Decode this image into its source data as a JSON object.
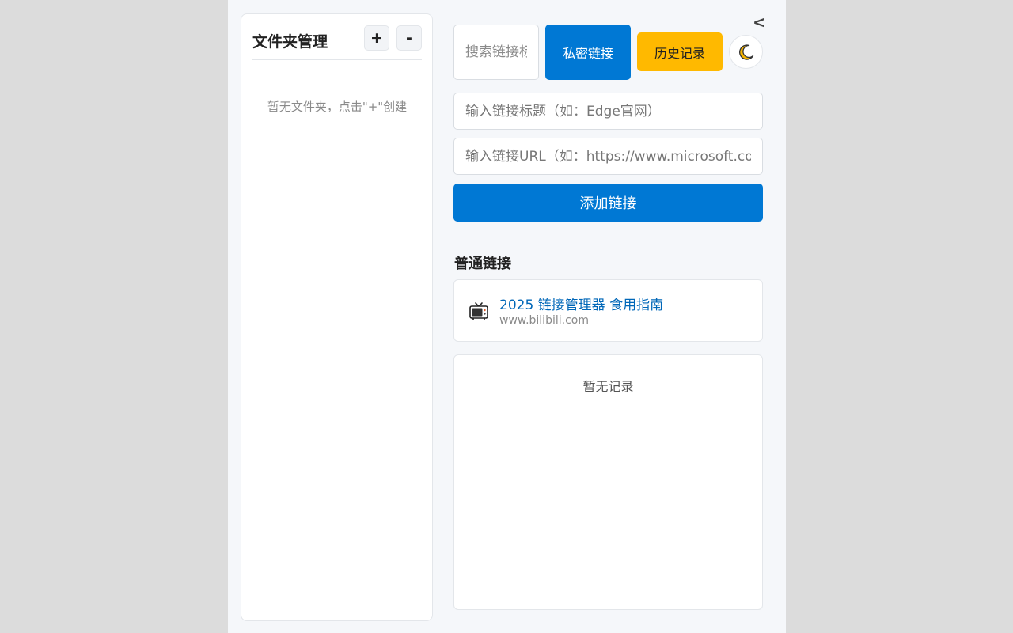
{
  "sidebar": {
    "title": "文件夹管理",
    "add_label": "+",
    "remove_label": "-",
    "empty_text": "暂无文件夹，点击\"+\"创建"
  },
  "header": {
    "collapse_label": "<",
    "search_placeholder": "搜索链接标题",
    "private_label": "私密链接",
    "history_label": "历史记录",
    "theme_icon": "moon-icon"
  },
  "form": {
    "title_placeholder": "输入链接标题（如：Edge官网）",
    "url_placeholder": "输入链接URL（如：https://www.microsoft.com）",
    "add_button": "添加链接"
  },
  "links": {
    "section_title": "普通链接",
    "items": [
      {
        "title": "2025 链接管理器 食用指南",
        "url": "www.bilibili.com",
        "icon": "tv-icon"
      }
    ]
  },
  "history": {
    "empty_text": "暂无记录"
  },
  "colors": {
    "primary": "#0078d4",
    "history": "#ffb900",
    "link_title": "#0067b8",
    "background": "#f5f7fa",
    "outer": "#dcdcdc"
  }
}
